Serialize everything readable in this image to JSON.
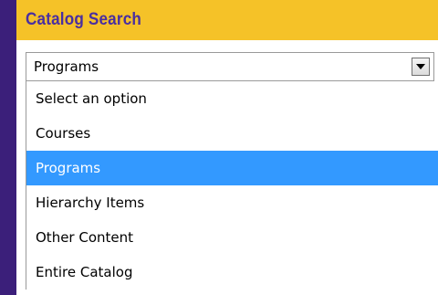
{
  "header": {
    "title": "Catalog Search"
  },
  "select": {
    "current_value": "Programs",
    "arrow_icon": "triangle-down-icon"
  },
  "options": [
    {
      "label": "Select an option",
      "selected": false
    },
    {
      "label": "Courses",
      "selected": false
    },
    {
      "label": "Programs",
      "selected": true
    },
    {
      "label": "Hierarchy Items",
      "selected": false
    },
    {
      "label": "Other Content",
      "selected": false
    },
    {
      "label": "Entire Catalog",
      "selected": false
    }
  ],
  "colors": {
    "background": "#3b1f7a",
    "header": "#f5c228",
    "title": "#4a2fa0",
    "highlight": "#3399ff"
  }
}
